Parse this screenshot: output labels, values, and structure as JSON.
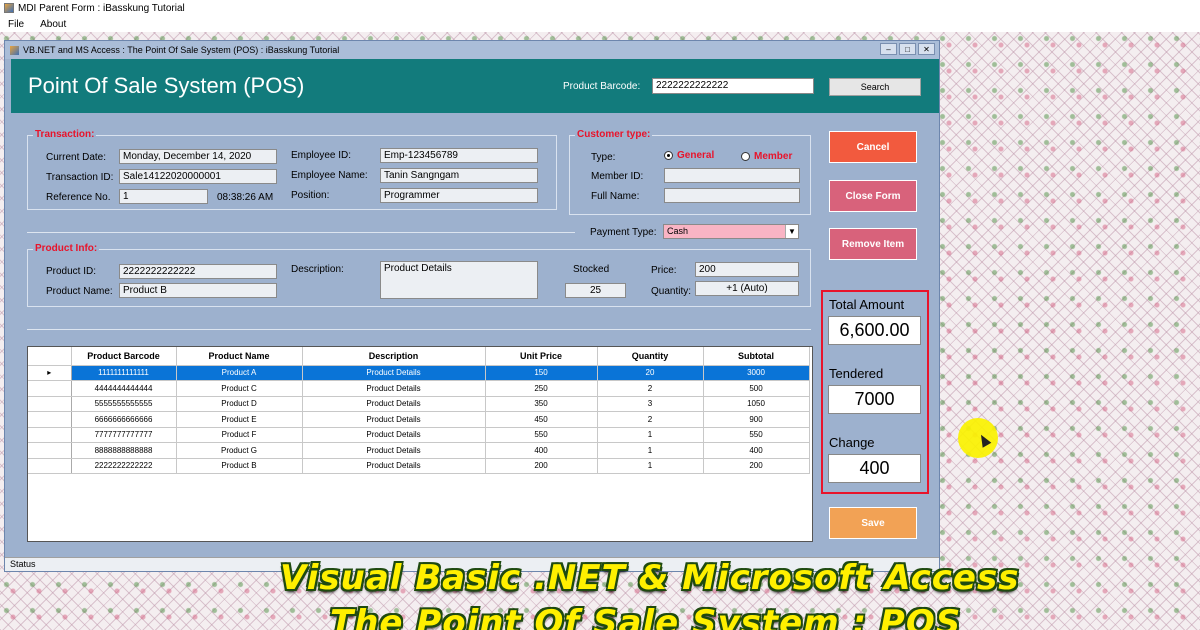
{
  "mdi": {
    "title": "MDI Parent Form : iBasskung Tutorial",
    "menu": [
      "File",
      "About"
    ]
  },
  "child": {
    "title": "VB.NET and MS Access : The Point Of Sale System (POS) : iBasskung Tutorial",
    "window_buttons": [
      "–",
      "□",
      "✕"
    ]
  },
  "header": {
    "title": "Point Of Sale System (POS)",
    "barcode_label": "Product Barcode:",
    "barcode_value": "2222222222222",
    "search_label": "Search"
  },
  "transaction": {
    "legend": "Transaction:",
    "current_date_label": "Current Date:",
    "current_date": "Monday, December 14, 2020",
    "transaction_id_label": "Transaction ID:",
    "transaction_id": "Sale14122020000001",
    "reference_label": "Reference No.",
    "reference": "1",
    "time": "08:38:26 AM",
    "employee_id_label": "Employee ID:",
    "employee_id": "Emp-123456789",
    "employee_name_label": "Employee Name:",
    "employee_name": "Tanin Sangngam",
    "position_label": "Position:",
    "position": "Programmer"
  },
  "customer": {
    "legend": "Customer type:",
    "type_label": "Type:",
    "general_label": "General",
    "member_label": "Member",
    "member_id_label": "Member ID:",
    "member_id": "",
    "full_name_label": "Full Name:",
    "full_name": ""
  },
  "payment": {
    "label": "Payment Type:",
    "value": "Cash"
  },
  "product": {
    "legend": "Product Info:",
    "id_label": "Product ID:",
    "id": "2222222222222",
    "name_label": "Product Name:",
    "name": "Product B",
    "description_label": "Description:",
    "description": "Product Details",
    "stocked_label": "Stocked",
    "stocked": "25",
    "price_label": "Price:",
    "price": "200",
    "quantity_label": "Quantity:",
    "quantity": "+1 (Auto)"
  },
  "buttons": {
    "cancel": "Cancel",
    "close_form": "Close Form",
    "remove_item": "Remove Item",
    "save": "Save"
  },
  "grid": {
    "columns": [
      "Product Barcode",
      "Product Name",
      "Description",
      "Unit Price",
      "Quantity",
      "Subtotal"
    ],
    "rows": [
      [
        "1111111111111",
        "Product A",
        "Product Details",
        "150",
        "20",
        "3000"
      ],
      [
        "4444444444444",
        "Product C",
        "Product Details",
        "250",
        "2",
        "500"
      ],
      [
        "5555555555555",
        "Product D",
        "Product Details",
        "350",
        "3",
        "1050"
      ],
      [
        "6666666666666",
        "Product E",
        "Product Details",
        "450",
        "2",
        "900"
      ],
      [
        "7777777777777",
        "Product F",
        "Product Details",
        "550",
        "1",
        "550"
      ],
      [
        "8888888888888",
        "Product G",
        "Product Details",
        "400",
        "1",
        "400"
      ],
      [
        "2222222222222",
        "Product B",
        "Product Details",
        "200",
        "1",
        "200"
      ]
    ],
    "selected_row": 0
  },
  "totals": {
    "total_label": "Total Amount",
    "total": "6,600.00",
    "tendered_label": "Tendered",
    "tendered": "7000",
    "change_label": "Change",
    "change": "400"
  },
  "status": "Status",
  "banner": {
    "line1": "Visual Basic .NET & Microsoft Access",
    "line2": "The Point Of Sale System : POS"
  },
  "colors": {
    "header": "#127b7c",
    "form_bg": "#9db1ce",
    "accent_red": "#e8142b",
    "cancel": "#f25a3e",
    "pink_button": "#d8627b",
    "save": "#f2a255",
    "selection": "#0a74d7"
  }
}
